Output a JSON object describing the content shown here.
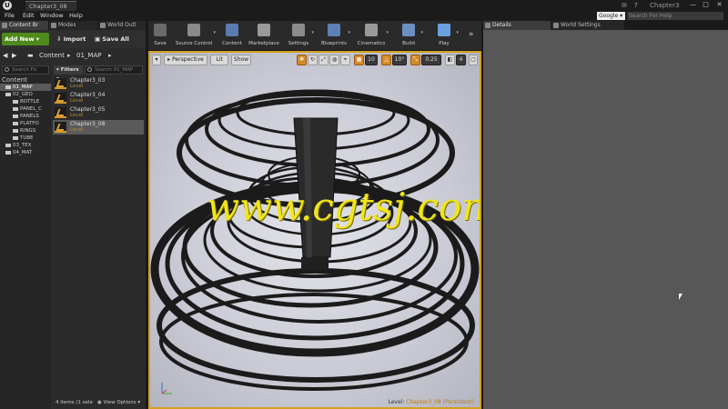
{
  "window": {
    "logo": "U",
    "doc_tab": "Chapter3_08",
    "project_name": "Chapter3",
    "min": "—",
    "max": "□",
    "close": "✕"
  },
  "menu": {
    "items": [
      "File",
      "Edit",
      "Window",
      "Help"
    ],
    "help_source": "Google",
    "help_search_placeholder": "Search For Help"
  },
  "left_tabs": [
    {
      "label": "Content Br"
    },
    {
      "label": "Modes"
    },
    {
      "label": "World Outl"
    }
  ],
  "content_browser": {
    "add_new": "Add New",
    "import": "Import",
    "save_all": "Save All",
    "path": [
      "Content",
      "01_MAP"
    ],
    "tree_search_placeholder": "Search Fo",
    "asset_search_placeholder": "Search 01_MAP",
    "filters": "Filters",
    "tree": [
      {
        "label": "Content",
        "level": 0,
        "root": true
      },
      {
        "label": "01_MAP",
        "level": 1,
        "selected": true
      },
      {
        "label": "02_GEO",
        "level": 1
      },
      {
        "label": "BOTTLE",
        "level": 2
      },
      {
        "label": "PANEL_C",
        "level": 2
      },
      {
        "label": "PANELS",
        "level": 2
      },
      {
        "label": "PLATFO",
        "level": 2
      },
      {
        "label": "RINGS",
        "level": 2
      },
      {
        "label": "TUBE",
        "level": 2
      },
      {
        "label": "03_TEX",
        "level": 1
      },
      {
        "label": "04_MAT",
        "level": 1
      }
    ],
    "assets": [
      {
        "name": "Chapter3_03",
        "type": "Level",
        "selected": false
      },
      {
        "name": "Chapter3_04",
        "type": "Level",
        "selected": false
      },
      {
        "name": "Chapter3_05",
        "type": "Level",
        "selected": false
      },
      {
        "name": "Chapter3_08",
        "type": "Level",
        "selected": true
      }
    ],
    "footer_count": "4 items (1 sele",
    "view_options": "View Options"
  },
  "toolbar": {
    "tools": [
      {
        "label": "Save",
        "color": "#6a6a6a"
      },
      {
        "label": "Source Control",
        "color": "#8a8a8a"
      },
      {
        "label": "Content",
        "color": "#5a7bb0"
      },
      {
        "label": "Marketplace",
        "color": "#9a9a9a"
      },
      {
        "label": "Settings",
        "color": "#8c8c8c"
      },
      {
        "label": "Blueprints",
        "color": "#5d7fb7"
      },
      {
        "label": "Cinematics",
        "color": "#9a9a9a"
      },
      {
        "label": "Build",
        "color": "#6c8fc4"
      },
      {
        "label": "Play",
        "color": "#6aa0e0"
      }
    ],
    "expand": "»"
  },
  "viewport": {
    "perspective": "Perspective",
    "lit": "Lit",
    "show": "Show",
    "grid_snap": "10",
    "rot_snap": "10°",
    "scale_snap": "0.25",
    "camera_speed": "4",
    "watermark": "www.cgtsj.com",
    "level_prefix": "Level:",
    "level_name": "Chapter3_08 (Persistent)",
    "border_color": "#d1a01e"
  },
  "right_tabs": [
    {
      "label": "Details"
    },
    {
      "label": "World Settings"
    }
  ]
}
